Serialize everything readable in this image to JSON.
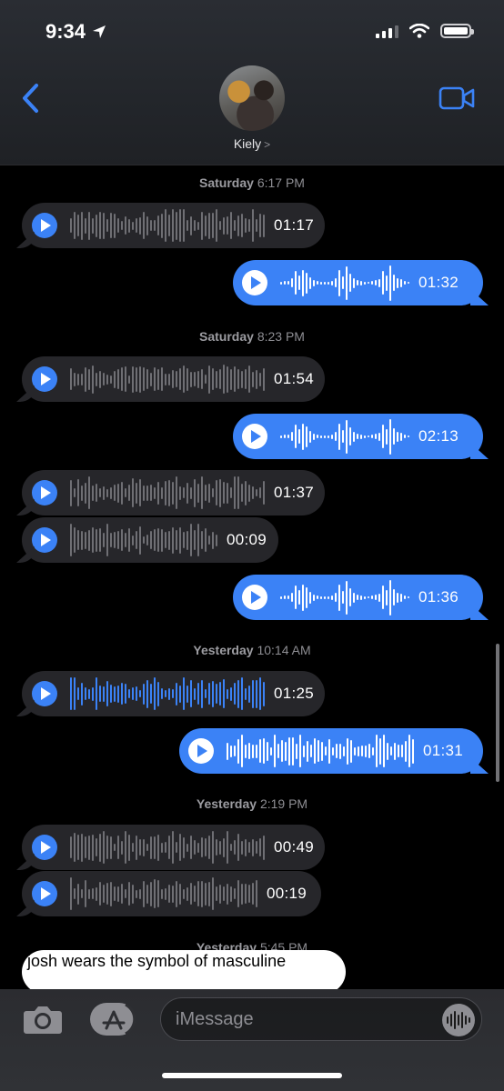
{
  "status_bar": {
    "time": "9:34",
    "location_icon": "location-arrow-icon",
    "signal_icon": "cellular-signal-icon",
    "wifi_icon": "wifi-icon",
    "battery_icon": "battery-icon"
  },
  "header": {
    "contact_name": "Kiely",
    "contact_chevron": ">",
    "back_icon": "chevron-left-icon",
    "video_icon": "video-camera-icon",
    "accent_color": "#3b82f6"
  },
  "thread": {
    "stamps": [
      {
        "day": "Saturday",
        "time": "6:17 PM"
      },
      {
        "day": "Saturday",
        "time": "8:23 PM"
      },
      {
        "day": "Yesterday",
        "time": "10:14 AM"
      },
      {
        "day": "Yesterday",
        "time": "2:19 PM"
      },
      {
        "day": "Yesterday",
        "time": "5:45 PM"
      }
    ],
    "messages": [
      {
        "direction": "incoming",
        "type": "audio",
        "duration": "01:17"
      },
      {
        "direction": "outgoing",
        "type": "audio",
        "duration": "01:32"
      },
      {
        "direction": "incoming",
        "type": "audio",
        "duration": "01:54"
      },
      {
        "direction": "outgoing",
        "type": "audio",
        "duration": "02:13"
      },
      {
        "direction": "incoming",
        "type": "audio",
        "duration": "01:37"
      },
      {
        "direction": "incoming",
        "type": "audio",
        "duration": "00:09"
      },
      {
        "direction": "outgoing",
        "type": "audio",
        "duration": "01:36"
      },
      {
        "direction": "incoming",
        "type": "audio",
        "duration": "01:25",
        "played": true
      },
      {
        "direction": "outgoing",
        "type": "audio",
        "duration": "01:31"
      },
      {
        "direction": "incoming",
        "type": "audio",
        "duration": "00:49"
      },
      {
        "direction": "incoming",
        "type": "audio",
        "duration": "00:19"
      },
      {
        "direction": "incoming",
        "type": "text",
        "text": "josh wears the symbol of masculine"
      }
    ]
  },
  "input_bar": {
    "placeholder": "iMessage",
    "camera_icon": "camera-icon",
    "appstore_icon": "app-store-icon",
    "audio_icon": "audio-waveform-icon"
  }
}
